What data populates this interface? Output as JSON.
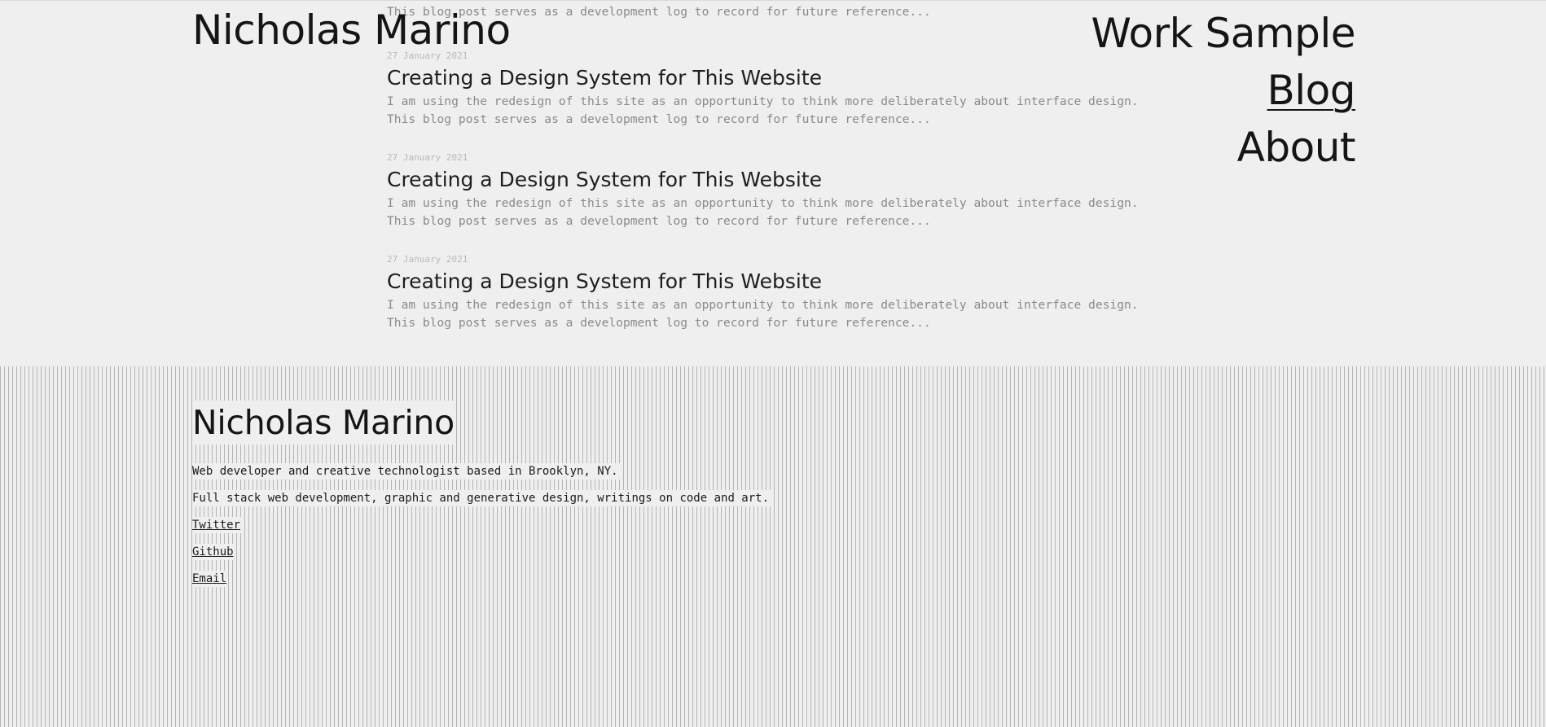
{
  "header": {
    "site_title": "Nicholas Marino",
    "nav": [
      {
        "label": "Work Sample",
        "active": false
      },
      {
        "label": "Blog",
        "active": true
      },
      {
        "label": "About",
        "active": false
      }
    ]
  },
  "posts": [
    {
      "date": "",
      "title": "",
      "excerpt": "I am using the redesign of this site as an opportunity to think more deliberately about interface design. This blog post serves as a development log to record for future reference..."
    },
    {
      "date": "27 January 2021",
      "title": "Creating a Design System for This Website",
      "excerpt": "I am using the redesign of this site as an opportunity to think more deliberately about interface design. This blog post serves as a development log to record for future reference..."
    },
    {
      "date": "27 January 2021",
      "title": "Creating a Design System for This Website",
      "excerpt": "I am using the redesign of this site as an opportunity to think more deliberately about interface design. This blog post serves as a development log to record for future reference..."
    },
    {
      "date": "27 January 2021",
      "title": "Creating a Design System for This Website",
      "excerpt": "I am using the redesign of this site as an opportunity to think more deliberately about interface design. This blog post serves as a development log to record for future reference..."
    }
  ],
  "footer": {
    "title": "Nicholas Marino",
    "tagline": "Web developer and creative technologist based in Brooklyn, NY.",
    "description": "Full stack web development, graphic and generative design, writings on code and art.",
    "links": [
      {
        "label": "Twitter"
      },
      {
        "label": "Github"
      },
      {
        "label": "Email"
      }
    ]
  },
  "colors": {
    "background": "#efefef",
    "text": "#1c1c1c",
    "muted_text": "#8a8a8a",
    "date_text": "#b9b9b9",
    "stripe": "#b5b5b5"
  }
}
